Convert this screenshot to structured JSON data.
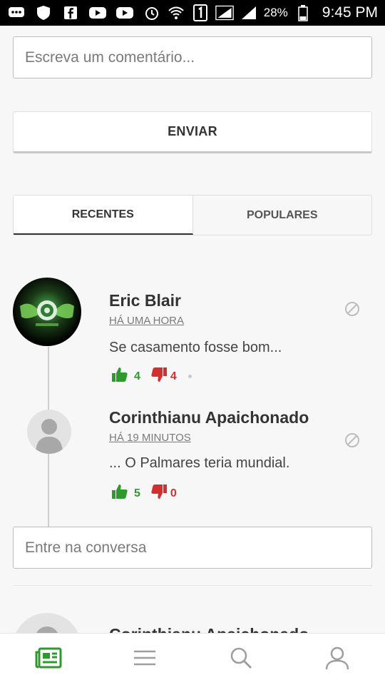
{
  "status_bar": {
    "battery": "28%",
    "time": "9:45 PM",
    "icons": [
      "chat-icon",
      "shield-icon",
      "facebook-icon",
      "youtube-icon",
      "youtube-icon",
      "alarm-icon",
      "wifi-icon",
      "sim-1-icon",
      "signal-icon",
      "signal-icon",
      "battery-icon"
    ]
  },
  "comment_form": {
    "placeholder": "Escreva um comentário...",
    "send_label": "ENVIAR"
  },
  "tabs": [
    {
      "label": "RECENTES",
      "active": true
    },
    {
      "label": "POPULARES",
      "active": false
    }
  ],
  "comments": [
    {
      "author": "Eric Blair",
      "time": "HÁ UMA HORA",
      "text": "Se casamento fosse bom...",
      "likes": "4",
      "dislikes": "4"
    },
    {
      "author": "Corinthianu Apaichonado",
      "time": "HÁ 19 MINUTOS",
      "text": "... O Palmares teria mundial.",
      "likes": "5",
      "dislikes": "0"
    }
  ],
  "reply_input": {
    "placeholder": "Entre na conversa"
  },
  "next_comment": {
    "author": "Corinthianu Apaichonado"
  },
  "bottom_nav": [
    {
      "icon": "news-icon",
      "active": true
    },
    {
      "icon": "menu-icon",
      "active": false
    },
    {
      "icon": "search-icon",
      "active": false
    },
    {
      "icon": "profile-icon",
      "active": false
    }
  ],
  "colors": {
    "accent_green": "#2e9a2e",
    "dislike_red": "#d32f2f"
  }
}
